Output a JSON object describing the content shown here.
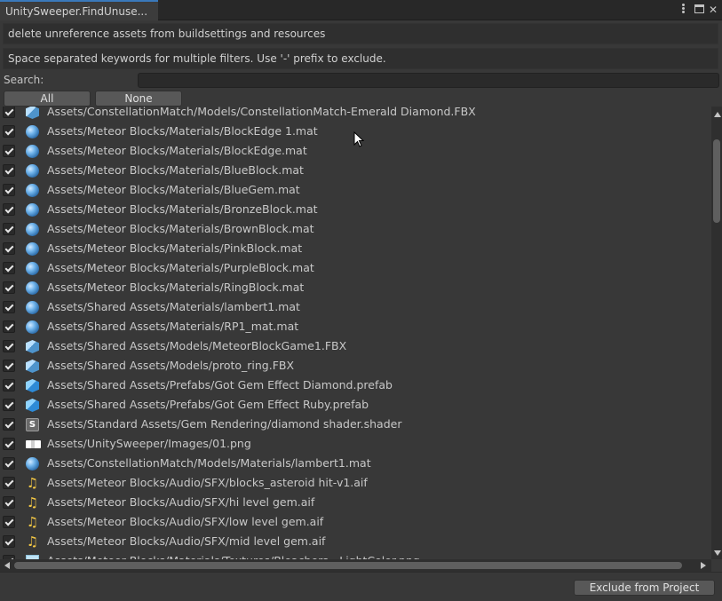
{
  "window": {
    "tab_title": "UnitySweeper.FindUnuse..."
  },
  "info": {
    "description": "delete unreference assets from buildsettings and resources",
    "hint": "Space separated keywords for multiple filters. Use '-' prefix to exclude."
  },
  "search": {
    "label": "Search:",
    "value": "",
    "placeholder": ""
  },
  "buttons": {
    "all": "All",
    "none": "None",
    "exclude": "Exclude from Project"
  },
  "assets": [
    {
      "path": "Assets/ConstellationMatch/Models/ConstellationMatch-Emerald Diamond.FBX",
      "icon": "model",
      "checked": true
    },
    {
      "path": "Assets/Meteor Blocks/Materials/BlockEdge 1.mat",
      "icon": "material",
      "checked": true
    },
    {
      "path": "Assets/Meteor Blocks/Materials/BlockEdge.mat",
      "icon": "material",
      "checked": true
    },
    {
      "path": "Assets/Meteor Blocks/Materials/BlueBlock.mat",
      "icon": "material",
      "checked": true
    },
    {
      "path": "Assets/Meteor Blocks/Materials/BlueGem.mat",
      "icon": "material",
      "checked": true
    },
    {
      "path": "Assets/Meteor Blocks/Materials/BronzeBlock.mat",
      "icon": "material",
      "checked": true
    },
    {
      "path": "Assets/Meteor Blocks/Materials/BrownBlock.mat",
      "icon": "material",
      "checked": true
    },
    {
      "path": "Assets/Meteor Blocks/Materials/PinkBlock.mat",
      "icon": "material",
      "checked": true
    },
    {
      "path": "Assets/Meteor Blocks/Materials/PurpleBlock.mat",
      "icon": "material",
      "checked": true
    },
    {
      "path": "Assets/Meteor Blocks/Materials/RingBlock.mat",
      "icon": "material",
      "checked": true
    },
    {
      "path": "Assets/Shared Assets/Materials/lambert1.mat",
      "icon": "material",
      "checked": true
    },
    {
      "path": "Assets/Shared Assets/Materials/RP1_mat.mat",
      "icon": "material",
      "checked": true
    },
    {
      "path": "Assets/Shared Assets/Models/MeteorBlockGame1.FBX",
      "icon": "model",
      "checked": true
    },
    {
      "path": "Assets/Shared Assets/Models/proto_ring.FBX",
      "icon": "model",
      "checked": true
    },
    {
      "path": "Assets/Shared Assets/Prefabs/Got Gem Effect Diamond.prefab",
      "icon": "prefab",
      "checked": true
    },
    {
      "path": "Assets/Shared Assets/Prefabs/Got Gem Effect Ruby.prefab",
      "icon": "prefab",
      "checked": true
    },
    {
      "path": "Assets/Standard Assets/Gem Rendering/diamond shader.shader",
      "icon": "shader",
      "checked": true
    },
    {
      "path": "Assets/UnitySweeper/Images/01.png",
      "icon": "image",
      "checked": true
    },
    {
      "path": "Assets/ConstellationMatch/Models/Materials/lambert1.mat",
      "icon": "material",
      "checked": true
    },
    {
      "path": "Assets/Meteor Blocks/Audio/SFX/blocks_asteroid hit-v1.aif",
      "icon": "audio",
      "checked": true
    },
    {
      "path": "Assets/Meteor Blocks/Audio/SFX/hi level gem.aif",
      "icon": "audio",
      "checked": true
    },
    {
      "path": "Assets/Meteor Blocks/Audio/SFX/low level gem.aif",
      "icon": "audio",
      "checked": true
    },
    {
      "path": "Assets/Meteor Blocks/Audio/SFX/mid level gem.aif",
      "icon": "audio",
      "checked": true
    },
    {
      "path": "Assets/Meteor Blocks/Materials/Textures/Bleachers - LightColor.png",
      "icon": "texture",
      "checked": true
    }
  ]
}
